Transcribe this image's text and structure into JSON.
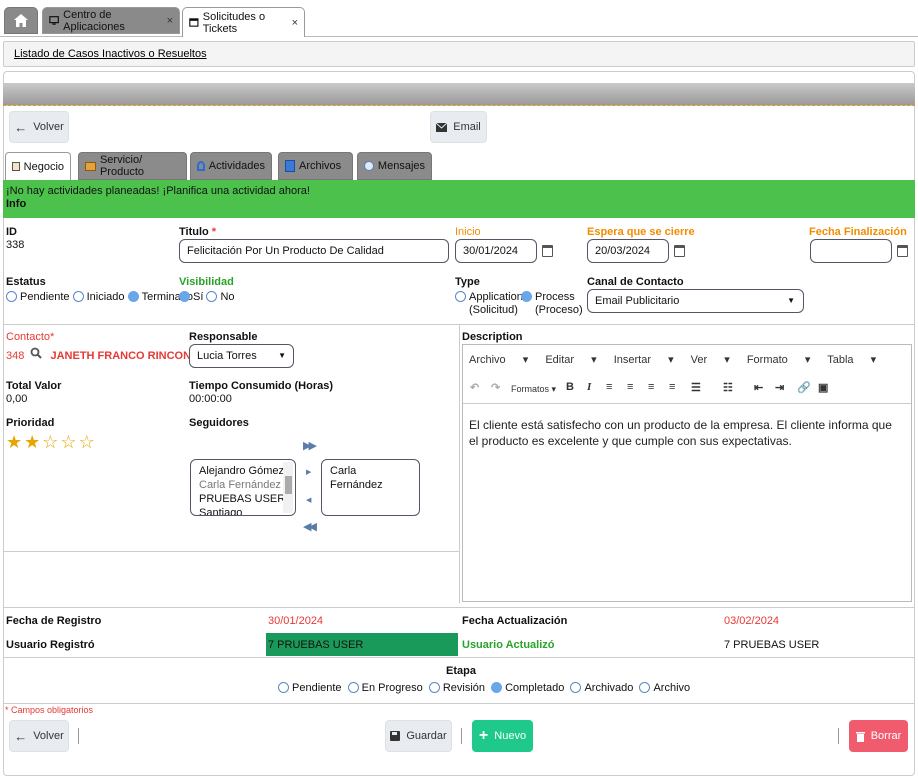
{
  "tabs": {
    "home_icon": "home-icon",
    "items": [
      {
        "label": "Centro de Aplicaciones",
        "icon": "monitor-icon"
      },
      {
        "label": "Solicitudes o Tickets",
        "icon": "window-icon"
      }
    ],
    "close": "×"
  },
  "breadcrumb": "Listado de Casos Inactivos o Resueltos",
  "toolbar": {
    "back": "Volver",
    "email": "Email"
  },
  "section_tabs": [
    "Negocio",
    "Servicio/ Producto",
    "Actividades",
    "Archivos",
    "Mensajes"
  ],
  "banner": {
    "line1": "¡No hay actividades planeadas! ¡Planifica una actividad ahora!",
    "line2": "Info"
  },
  "form": {
    "id_label": "ID",
    "id_value": "338",
    "titulo_label": "Titulo",
    "required_mark": "*",
    "titulo_value": "Felicitación Por Un Producto De Calidad",
    "inicio_label": "Inicio",
    "inicio_value": "30/01/2024",
    "espera_label": "Espera que se cierre",
    "espera_value": "20/03/2024",
    "fin_label": "Fecha Finalización",
    "fin_value": "",
    "estatus_label": "Estatus",
    "estatus_options": [
      "Pendiente",
      "Iniciado",
      "Terminado"
    ],
    "estatus_selected": "Terminado",
    "visibilidad_label": "Visibilidad",
    "visibilidad_options": [
      "Sí",
      "No"
    ],
    "visibilidad_selected": "Sí",
    "type_label": "Type",
    "type_options": [
      {
        "l1": "Application",
        "l2": "(Solicitud)"
      },
      {
        "l1": "Process",
        "l2": "(Proceso)"
      }
    ],
    "type_selected": "Process",
    "canal_label": "Canal de Contacto",
    "canal_value": "Email Publicitario",
    "contacto_label": "Contacto",
    "contacto_id": "348",
    "contacto_name": "JANETH FRANCO RINCON",
    "responsable_label": "Responsable",
    "responsable_value": "Lucia Torres",
    "total_label": "Total Valor",
    "total_value": "0,00",
    "tiempo_label": "Tiempo Consumido (Horas)",
    "tiempo_value": "00:00:00",
    "prioridad_label": "Prioridad",
    "prioridad_rating": 2,
    "prioridad_max": 5,
    "seguidores_label": "Seguidores",
    "seguidores_available": [
      "Alejandro Gómez",
      "Carla Fernández",
      "PRUEBAS USER",
      "Santiago Ramírez"
    ],
    "seguidores_selected": [
      "Carla Fernández"
    ],
    "description_label": "Description",
    "editor_menu": [
      "Archivo",
      "Editar",
      "Insertar",
      "Ver",
      "Formato",
      "Tabla"
    ],
    "editor_formats": "Formatos",
    "description_text": "El cliente está satisfecho con un producto de la empresa. El cliente informa que el producto es excelente y que cumple con sus expectativas.",
    "registro_label": "Fecha de Registro",
    "registro_value": "30/01/2024",
    "actualizacion_label": "Fecha Actualización",
    "actualizacion_value": "03/02/2024",
    "usuario_registro_label": "Usuario Registró",
    "usuario_registro_value": "7 PRUEBAS USER",
    "usuario_actualizo_label": "Usuario Actualizó",
    "usuario_actualizo_value": "7 PRUEBAS USER",
    "etapa_label": "Etapa",
    "etapa_options": [
      "Pendiente",
      "En Progreso",
      "Revisión",
      "Completado",
      "Archivado",
      "Archivo"
    ],
    "etapa_selected": "Completado",
    "required_note": "* Campos obligatorios"
  },
  "footer": {
    "back": "Volver",
    "save": "Guardar",
    "new": "Nuevo",
    "delete": "Borrar"
  },
  "colors": {
    "banner": "#4cc24c",
    "user_registro_bg": "#1a9a5a",
    "nuevo": "#1fc98b",
    "borrar": "#f05b6e",
    "required": "#e53935",
    "orange": "#f28c00"
  }
}
